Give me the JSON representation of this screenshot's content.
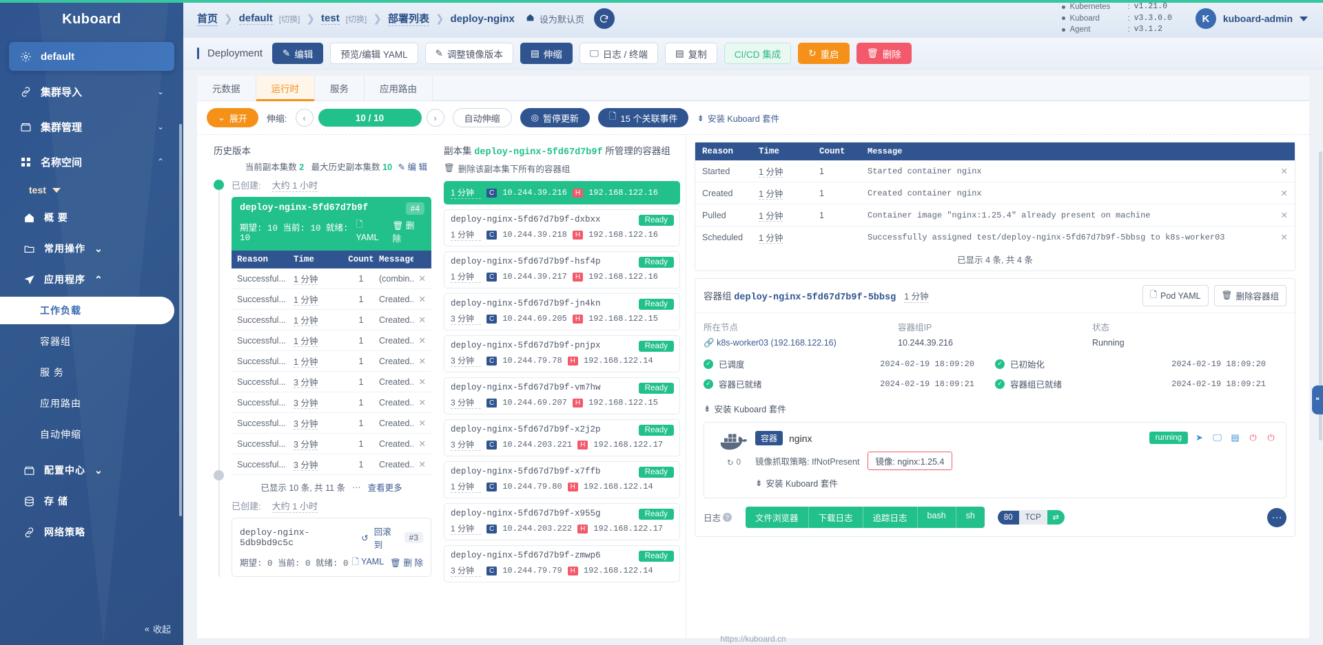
{
  "brand": {
    "name": "Kuboard"
  },
  "sidebar": {
    "default_item": "default",
    "items": [
      {
        "label": "集群导入",
        "icon": "link-icon"
      },
      {
        "label": "集群管理",
        "icon": "box-icon"
      },
      {
        "label": "名称空间",
        "icon": "grid-icon"
      }
    ],
    "namespace": "test",
    "subitems": [
      {
        "label": "概 要",
        "icon": "home-icon"
      },
      {
        "label": "常用操作",
        "icon": "folder-icon"
      },
      {
        "label": "应用程序",
        "icon": "send-icon"
      }
    ],
    "app_children": [
      {
        "label": "工作负载",
        "active": true
      },
      {
        "label": "容器组",
        "active": false
      },
      {
        "label": "服 务",
        "active": false
      },
      {
        "label": "应用路由",
        "active": false
      },
      {
        "label": "自动伸缩",
        "active": false
      }
    ],
    "bottom_items": [
      {
        "label": "配置中心",
        "icon": "box-icon"
      },
      {
        "label": "存 储",
        "icon": "database-icon"
      },
      {
        "label": "网络策略",
        "icon": "link-icon"
      }
    ],
    "collapse_label": "收起"
  },
  "header": {
    "breadcrumbs": [
      {
        "label": "首页",
        "type": "link"
      },
      {
        "label": "default",
        "type": "dotted",
        "switch": "[切换]"
      },
      {
        "label": "test",
        "type": "dotted",
        "switch": "[切换]"
      },
      {
        "label": "部署列表",
        "type": "dotted"
      },
      {
        "label": "deploy-nginx",
        "type": "current"
      }
    ],
    "set_default_label": "设为默认页",
    "refresh_icon": "refresh-icon",
    "versions": [
      {
        "name": "Kubernetes",
        "value": "v1.21.0"
      },
      {
        "name": "Kuboard",
        "value": "v3.3.0.0"
      },
      {
        "name": "Agent",
        "value": "v3.1.2"
      }
    ],
    "user": {
      "initial": "K",
      "name": "kuboard-admin"
    }
  },
  "toolbar": {
    "kind": "Deployment",
    "buttons": [
      {
        "label": "编辑",
        "style": "primary",
        "icon": "edit-icon"
      },
      {
        "label": "预览/编辑 YAML",
        "style": "plain",
        "icon": ""
      },
      {
        "label": "调整镜像版本",
        "style": "plain",
        "icon": "pencil-icon"
      },
      {
        "label": "伸缩",
        "style": "primary",
        "icon": "copy-icon"
      },
      {
        "label": "日志 / 终端",
        "style": "plain",
        "icon": "monitor-icon"
      },
      {
        "label": "复制",
        "style": "plain",
        "icon": "copy-icon"
      },
      {
        "label": "CI/CD 集成",
        "style": "success-o",
        "icon": ""
      },
      {
        "label": "重启",
        "style": "warning",
        "icon": "restart-icon"
      },
      {
        "label": "删除",
        "style": "danger",
        "icon": "trash-icon"
      }
    ]
  },
  "tabs": [
    {
      "label": "元数据",
      "active": false
    },
    {
      "label": "运行时",
      "active": true
    },
    {
      "label": "服务",
      "active": false
    },
    {
      "label": "应用路由",
      "active": false
    }
  ],
  "controls": {
    "expand_label": "展开",
    "scale_label": "伸缩:",
    "scale_value": "10 / 10",
    "autoscale_label": "自动伸缩",
    "pause_label": "暂停更新",
    "events_label": "15 个关联事件",
    "install_label": "安装 Kuboard 套件"
  },
  "history": {
    "title": "历史版本",
    "meta_current_label": "当前副本集数",
    "meta_current_value": "2",
    "meta_max_label": "最大历史副本集数",
    "meta_max_value": "10",
    "edit_label": "编 辑",
    "entries": [
      {
        "created_label": "已创建:",
        "created_value": "大约 1 小时",
        "name": "deploy-nginx-5fd67d7b9f",
        "badge": "#4",
        "stats": "期望: 10 当前: 10 就绪: 10",
        "yaml_label": "YAML",
        "delete_label": "删 除",
        "active": true
      },
      {
        "created_label": "已创建:",
        "created_value": "大约 1 小时",
        "name": "deploy-nginx-5db9bd9c5c",
        "badge": "#3",
        "stats": "期望: 0 当前: 0 就绪: 0",
        "rollback_label": "回滚到",
        "yaml_label": "YAML",
        "delete_label": "删 除",
        "active": false
      }
    ],
    "event_headers": [
      "Reason",
      "Time",
      "Count",
      "Message"
    ],
    "events": [
      {
        "reason": "Successful...",
        "time": "1 分钟",
        "count": "1",
        "message": "(combin..."
      },
      {
        "reason": "Successful...",
        "time": "1 分钟",
        "count": "1",
        "message": "Created..."
      },
      {
        "reason": "Successful...",
        "time": "1 分钟",
        "count": "1",
        "message": "Created..."
      },
      {
        "reason": "Successful...",
        "time": "1 分钟",
        "count": "1",
        "message": "Created..."
      },
      {
        "reason": "Successful...",
        "time": "1 分钟",
        "count": "1",
        "message": "Created..."
      },
      {
        "reason": "Successful...",
        "time": "3 分钟",
        "count": "1",
        "message": "Created..."
      },
      {
        "reason": "Successful...",
        "time": "3 分钟",
        "count": "1",
        "message": "Created..."
      },
      {
        "reason": "Successful...",
        "time": "3 分钟",
        "count": "1",
        "message": "Created..."
      },
      {
        "reason": "Successful...",
        "time": "3 分钟",
        "count": "1",
        "message": "Created..."
      },
      {
        "reason": "Successful...",
        "time": "3 分钟",
        "count": "1",
        "message": "Created..."
      }
    ],
    "footer_count": "已显示 10 条, 共 11 条",
    "footer_more": "查看更多"
  },
  "pods": {
    "title_prefix": "副本集",
    "title_name": "deploy-nginx-5fd67d7b9f",
    "title_suffix": "所管理的容器组",
    "delete_all_label": "删除该副本集下所有的容器组",
    "list": [
      {
        "name": "",
        "selected": true,
        "ready": "",
        "age": "1 分钟",
        "pod_ip": "10.244.39.216",
        "node_ip": "192.168.122.16"
      },
      {
        "name": "deploy-nginx-5fd67d7b9f-dxbxx",
        "selected": false,
        "ready": "Ready",
        "age": "1 分钟",
        "pod_ip": "10.244.39.218",
        "node_ip": "192.168.122.16"
      },
      {
        "name": "deploy-nginx-5fd67d7b9f-hsf4p",
        "selected": false,
        "ready": "Ready",
        "age": "1 分钟",
        "pod_ip": "10.244.39.217",
        "node_ip": "192.168.122.16"
      },
      {
        "name": "deploy-nginx-5fd67d7b9f-jn4kn",
        "selected": false,
        "ready": "Ready",
        "age": "3 分钟",
        "pod_ip": "10.244.69.205",
        "node_ip": "192.168.122.15"
      },
      {
        "name": "deploy-nginx-5fd67d7b9f-pnjpx",
        "selected": false,
        "ready": "Ready",
        "age": "3 分钟",
        "pod_ip": "10.244.79.78",
        "node_ip": "192.168.122.14"
      },
      {
        "name": "deploy-nginx-5fd67d7b9f-vm7hw",
        "selected": false,
        "ready": "Ready",
        "age": "3 分钟",
        "pod_ip": "10.244.69.207",
        "node_ip": "192.168.122.15"
      },
      {
        "name": "deploy-nginx-5fd67d7b9f-x2j2p",
        "selected": false,
        "ready": "Ready",
        "age": "3 分钟",
        "pod_ip": "10.244.203.221",
        "node_ip": "192.168.122.17"
      },
      {
        "name": "deploy-nginx-5fd67d7b9f-x7ffb",
        "selected": false,
        "ready": "Ready",
        "age": "1 分钟",
        "pod_ip": "10.244.79.80",
        "node_ip": "192.168.122.14"
      },
      {
        "name": "deploy-nginx-5fd67d7b9f-x955g",
        "selected": false,
        "ready": "Ready",
        "age": "1 分钟",
        "pod_ip": "10.244.203.222",
        "node_ip": "192.168.122.17"
      },
      {
        "name": "deploy-nginx-5fd67d7b9f-zmwp6",
        "selected": false,
        "ready": "Ready",
        "age": "3 分钟",
        "pod_ip": "10.244.79.79",
        "node_ip": "192.168.122.14"
      }
    ]
  },
  "event_panel": {
    "headers": [
      "Reason",
      "Time",
      "Count",
      "Message"
    ],
    "rows": [
      {
        "reason": "Started",
        "time": "1 分钟",
        "count": "1",
        "message": "Started container nginx"
      },
      {
        "reason": "Created",
        "time": "1 分钟",
        "count": "1",
        "message": "Created container nginx"
      },
      {
        "reason": "Pulled",
        "time": "1 分钟",
        "count": "1",
        "message": "Container image \"nginx:1.25.4\" already present on machine"
      },
      {
        "reason": "Scheduled",
        "time": "1 分钟",
        "count": "",
        "message": "Successfully assigned test/deploy-nginx-5fd67d7b9f-5bbsg to k8s-worker03"
      }
    ],
    "footer": "已显示 4 条, 共 4 条"
  },
  "pod_detail": {
    "title_prefix": "容器组",
    "title_name": "deploy-nginx-5fd67d7b9f-5bbsg",
    "age": "1 分钟",
    "yaml_btn": "Pod YAML",
    "delete_btn": "删除容器组",
    "fields": [
      {
        "label": "所在节点",
        "value": "k8s-worker03  (192.168.122.16)",
        "link": true
      },
      {
        "label": "容器组IP",
        "value": "10.244.39.216",
        "link": false
      },
      {
        "label": "状态",
        "value": "Running",
        "link": false
      }
    ],
    "conditions": [
      {
        "label": "已调度",
        "time": "2024-02-19 18:09:20"
      },
      {
        "label": "已初始化",
        "time": "2024-02-19 18:09:20"
      },
      {
        "label": "容器已就绪",
        "time": "2024-02-19 18:09:21"
      },
      {
        "label": "容器组已就绪",
        "time": "2024-02-19 18:09:21"
      }
    ],
    "install_label": "安装 Kuboard 套件",
    "container": {
      "chip": "容器",
      "name": "nginx",
      "restarts": "0",
      "pull_policy_label": "镜像抓取策略: IfNotPresent",
      "image": "镜像: nginx:1.25.4",
      "install_label": "安装 Kuboard 套件",
      "status": "running",
      "log_label": "日志",
      "actions": [
        "文件浏览器",
        "下载日志",
        "追踪日志",
        "bash",
        "sh"
      ],
      "port": "80",
      "protocol": "TCP"
    }
  },
  "footer": {
    "url": "https://kuboard.cn"
  }
}
